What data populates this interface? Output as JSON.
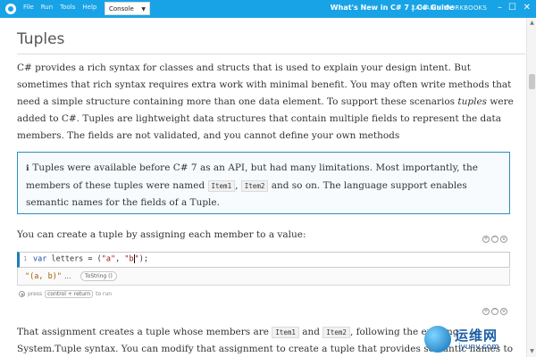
{
  "titlebar": {
    "menu": [
      "File",
      "Run",
      "Tools",
      "Help"
    ],
    "view_select": "Console",
    "title": "What's New in C# 7 | C# Guide",
    "brand": "XAMARIN WORKBOOKS",
    "controls": {
      "minimize": "–",
      "maximize": "☐",
      "close": "✕"
    }
  },
  "article": {
    "heading": "Tuples",
    "para1_a": "C# provides a rich syntax for classes and structs that is used to explain your design intent. But sometimes that rich syntax requires extra work with minimal benefit. You may often write methods that need a simple structure containing more than one data element. To support these scenarios ",
    "para1_em": "tuples",
    "para1_b": " were added to C#. Tuples are lightweight data structures that contain multiple fields to represent the data members. The fields are not validated, and you cannot define your own methods",
    "callout": {
      "icon": "info-icon",
      "text_a": "Tuples were available before C# 7 as an API, but had many limitations. Most importantly, the members of these tuples were named ",
      "code1": "Item1",
      "sep": ", ",
      "code2": "Item2",
      "text_b": " and so on. The language support enables semantic names for the fields of a Tuple."
    },
    "para2": "You can create a tuple by assigning each member to a value:",
    "para3_a": "That assignment creates a tuple whose members are ",
    "para3_code1": "Item1",
    "para3_and": " and ",
    "para3_code2": "Item2",
    "para3_b": ", following the existing System.Tuple syntax. You can modify that assignment to create a tuple that provides semantic names to each of the members of the tuple:"
  },
  "cell": {
    "line_number": "1",
    "code_kw": "var",
    "code_ident": " letters = (",
    "code_str1": "\"a\"",
    "code_sep": ", ",
    "code_str2_a": "\"b",
    "code_str2_b": "\"",
    "code_end": ");",
    "result": "\"(a, b)\"",
    "result_more": "...",
    "tostring": "ToString ()",
    "hint_press": "press",
    "hint_keys": "control + return",
    "hint_to_run": "to run",
    "action_add": "+",
    "action_up": "^",
    "action_down": "v"
  },
  "scroll": {
    "up": "▲",
    "down": "▼"
  },
  "watermark": {
    "main": "运维网",
    "sub": "iyunv.com"
  },
  "colors": {
    "titlebar": "#18a3e6",
    "accent": "#1d7db8",
    "callout_border": "#2a8fbd",
    "result_value": "#a55b00"
  }
}
